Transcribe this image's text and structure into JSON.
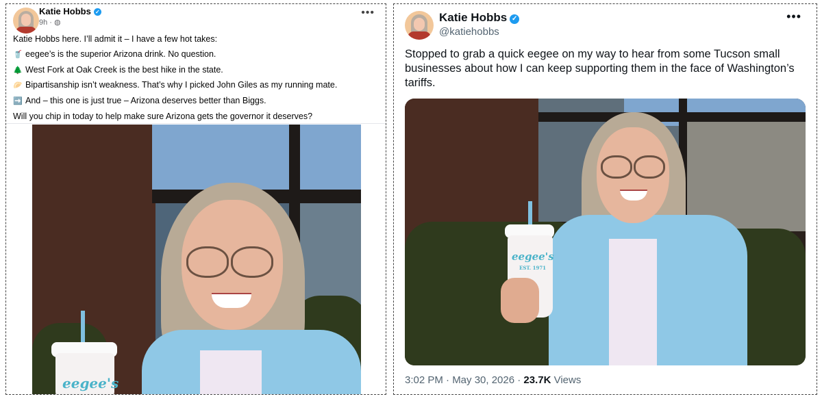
{
  "facebook_post": {
    "author": "Katie Hobbs",
    "time": "9h",
    "visibility_icon": "globe-icon",
    "lines": [
      {
        "emoji": "",
        "text": "Katie Hobbs here. I’ll admit it – I have a few hot takes:"
      },
      {
        "emoji": "🥤",
        "text": "eegee’s is the superior Arizona drink. No question."
      },
      {
        "emoji": "🌲",
        "text": "West Fork at Oak Creek is the best hike in the state."
      },
      {
        "emoji": "🥟",
        "text": "Bipartisanship isn’t weakness. That’s why I picked John Giles as my running mate."
      },
      {
        "emoji": "➡️",
        "text": "And – this one is just true – Arizona deserves better than Biggs."
      },
      {
        "emoji": "",
        "text": "Will you chip in today to help make sure Arizona gets the governor it deserves?"
      }
    ],
    "photo_cup_logo": "eegee's"
  },
  "tweet": {
    "author": "Katie Hobbs",
    "handle": "@katiehobbs",
    "text": "Stopped to grab a quick eegee on my way to hear from some Tucson small businesses about how I can keep supporting them in the face of Washington’s tariffs.",
    "timestamp": "3:02 PM · May 30, 2026 · ",
    "views_count": "23.7K",
    "views_label": " Views",
    "photo_cup_logo": "eegee's",
    "photo_cup_sublabel": "EST. 1971"
  },
  "colors": {
    "verified_blue": "#1d9bf0",
    "muted_text": "#65676b",
    "tweet_muted": "#536471"
  }
}
